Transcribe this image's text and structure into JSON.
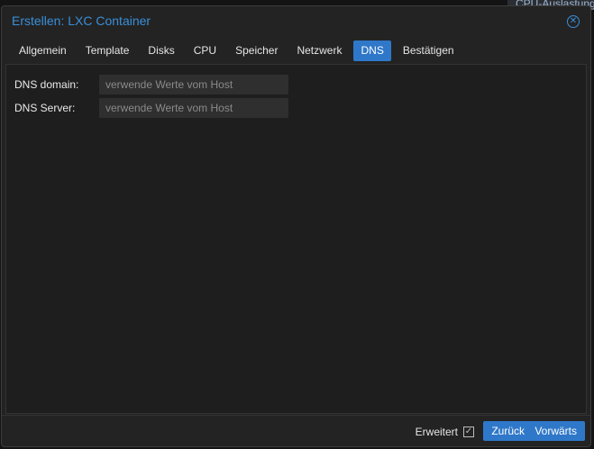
{
  "background": {
    "peek_label": "CPU-Auslastung"
  },
  "dialog": {
    "title": "Erstellen: LXC Container",
    "close_icon": "close-circle-icon"
  },
  "tabs": [
    {
      "label": "Allgemein",
      "active": false
    },
    {
      "label": "Template",
      "active": false
    },
    {
      "label": "Disks",
      "active": false
    },
    {
      "label": "CPU",
      "active": false
    },
    {
      "label": "Speicher",
      "active": false
    },
    {
      "label": "Netzwerk",
      "active": false
    },
    {
      "label": "DNS",
      "active": true
    },
    {
      "label": "Bestätigen",
      "active": false
    }
  ],
  "form": {
    "dns_domain": {
      "label": "DNS domain:",
      "value": "",
      "placeholder": "verwende Werte vom Host"
    },
    "dns_server": {
      "label": "DNS Server:",
      "value": "",
      "placeholder": "verwende Werte vom Host"
    }
  },
  "footer": {
    "advanced_label": "Erweitert",
    "advanced_checked": true,
    "back_label": "Zurück",
    "next_label": "Vorwärts"
  },
  "colors": {
    "accent": "#2f78c9",
    "title": "#3a8fd9",
    "dialog_bg": "#232323"
  }
}
